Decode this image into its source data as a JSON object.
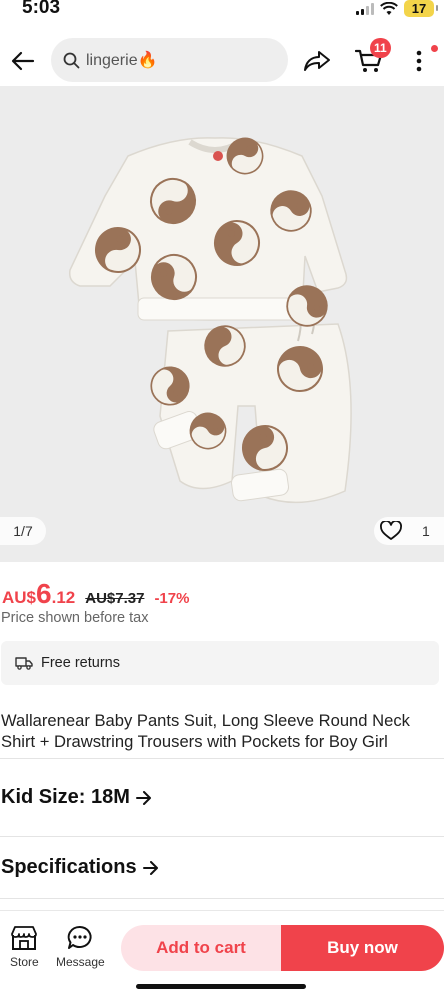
{
  "status_bar": {
    "time": "5:03",
    "battery": "17"
  },
  "header": {
    "search_query": "lingerie🔥",
    "cart_count": "11",
    "icons": [
      "back-arrow-icon",
      "search-icon",
      "share-icon",
      "cart-icon",
      "more-vert-icon"
    ]
  },
  "gallery": {
    "counter": "1/7",
    "likes": "1"
  },
  "price": {
    "currency": "AU$",
    "integer": "6",
    "decimal": ".12",
    "original": "AU$7.37",
    "discount": "-17%",
    "tax_note": "Price shown before tax"
  },
  "returns": {
    "label": "Free returns"
  },
  "product_title": "Wallarenear Baby Pants Suit, Long Sleeve Round Neck Shirt + Drawstring Trousers with Pockets for Boy Girl",
  "size_row": {
    "label": "Kid Size: 18M"
  },
  "specs_row": {
    "label": "Specifications"
  },
  "bottom_bar": {
    "store_label": "Store",
    "message_label": "Message",
    "add_to_cart": "Add to cart",
    "buy_now": "Buy now"
  },
  "colors": {
    "accent": "#f0434b",
    "accent_light": "#fde2e6",
    "pattern": "#9a7358"
  }
}
